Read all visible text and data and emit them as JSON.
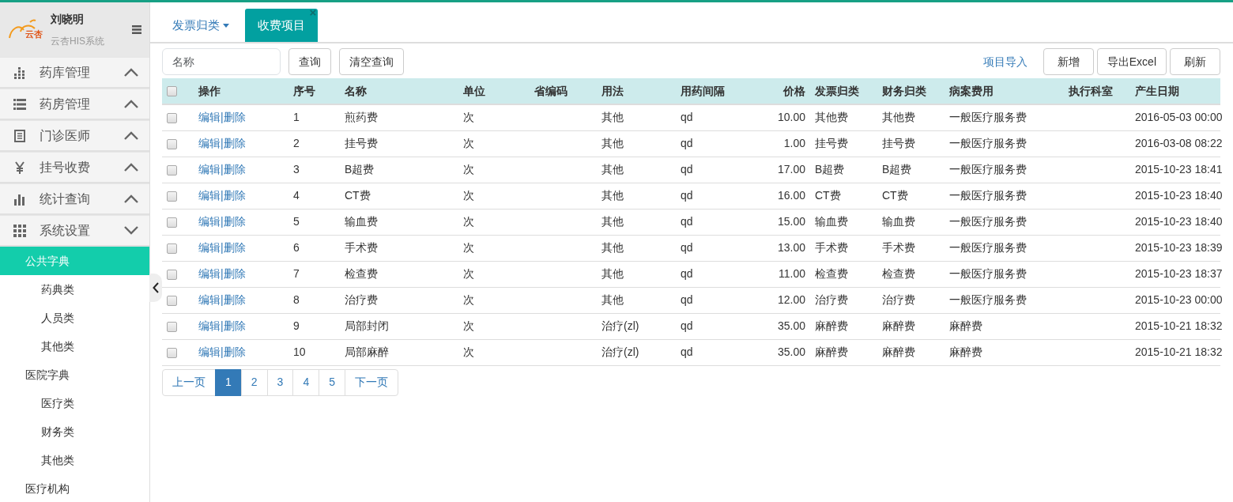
{
  "sidebar": {
    "logo_text": "云杏",
    "user_name": "刘晓明",
    "system_name": "云杏HIS系统",
    "menu": [
      {
        "label": "药库管理",
        "expanded": false
      },
      {
        "label": "药房管理",
        "expanded": false
      },
      {
        "label": "门诊医师",
        "expanded": false
      },
      {
        "label": "挂号收费",
        "expanded": false
      },
      {
        "label": "统计查询",
        "expanded": false
      },
      {
        "label": "系统设置",
        "expanded": true,
        "children": [
          {
            "label": "公共字典",
            "selected": true,
            "children": [
              {
                "label": "药典类",
                "selected": false
              },
              {
                "label": "人员类",
                "selected": false
              },
              {
                "label": "其他类",
                "selected": false
              }
            ]
          },
          {
            "label": "医院字典",
            "selected": false,
            "children": [
              {
                "label": "医疗类",
                "selected": false
              },
              {
                "label": "财务类",
                "selected": false
              },
              {
                "label": "其他类",
                "selected": false
              }
            ]
          },
          {
            "label": "医疗机构",
            "selected": false
          }
        ]
      }
    ]
  },
  "tabs": [
    {
      "label": "发票归类",
      "kind": "dropdown",
      "selected": false
    },
    {
      "label": "收费项目",
      "kind": "closable",
      "selected": true,
      "close": "×"
    }
  ],
  "toolbar": {
    "search": {
      "placeholder": "名称"
    },
    "left_buttons": [
      "查询",
      "清空查询"
    ],
    "import_link": "项目导入",
    "right_buttons": [
      "新增",
      "导出Excel",
      "刷新"
    ]
  },
  "table": {
    "select_all": false,
    "action_column": "操作",
    "columns": [
      "序号",
      "名称",
      "单位",
      "省编码",
      "用法",
      "用药间隔",
      "价格",
      "发票归类",
      "财务归类",
      "病案费用",
      "执行科室",
      "产生日期"
    ],
    "rows": [
      {
        "checked": false,
        "edit": "编辑",
        "sep": "|",
        "delete": "删除",
        "cells": [
          "1",
          "煎药费",
          "次",
          "",
          "其他",
          "qd",
          "10.00",
          "其他费",
          "其他费",
          "一般医疗服务费",
          "",
          "2016-05-03 00:00"
        ]
      },
      {
        "checked": false,
        "edit": "编辑",
        "sep": "|",
        "delete": "删除",
        "cells": [
          "2",
          "挂号费",
          "次",
          "",
          "其他",
          "qd",
          "1.00",
          "挂号费",
          "挂号费",
          "一般医疗服务费",
          "",
          "2016-03-08 08:22"
        ]
      },
      {
        "checked": false,
        "edit": "编辑",
        "sep": "|",
        "delete": "删除",
        "cells": [
          "3",
          "B超费",
          "次",
          "",
          "其他",
          "qd",
          "17.00",
          "B超费",
          "B超费",
          "一般医疗服务费",
          "",
          "2015-10-23 18:41"
        ]
      },
      {
        "checked": false,
        "edit": "编辑",
        "sep": "|",
        "delete": "删除",
        "cells": [
          "4",
          "CT费",
          "次",
          "",
          "其他",
          "qd",
          "16.00",
          "CT费",
          "CT费",
          "一般医疗服务费",
          "",
          "2015-10-23 18:40"
        ]
      },
      {
        "checked": false,
        "edit": "编辑",
        "sep": "|",
        "delete": "删除",
        "cells": [
          "5",
          "输血费",
          "次",
          "",
          "其他",
          "qd",
          "15.00",
          "输血费",
          "输血费",
          "一般医疗服务费",
          "",
          "2015-10-23 18:40"
        ]
      },
      {
        "checked": false,
        "edit": "编辑",
        "sep": "|",
        "delete": "删除",
        "cells": [
          "6",
          "手术费",
          "次",
          "",
          "其他",
          "qd",
          "13.00",
          "手术费",
          "手术费",
          "一般医疗服务费",
          "",
          "2015-10-23 18:39"
        ]
      },
      {
        "checked": false,
        "edit": "编辑",
        "sep": "|",
        "delete": "删除",
        "cells": [
          "7",
          "检查费",
          "次",
          "",
          "其他",
          "qd",
          "11.00",
          "检查费",
          "检查费",
          "一般医疗服务费",
          "",
          "2015-10-23 18:37"
        ]
      },
      {
        "checked": false,
        "edit": "编辑",
        "sep": "|",
        "delete": "删除",
        "cells": [
          "8",
          "治疗费",
          "次",
          "",
          "其他",
          "qd",
          "12.00",
          "治疗费",
          "治疗费",
          "一般医疗服务费",
          "",
          "2015-10-23 00:00"
        ]
      },
      {
        "checked": false,
        "edit": "编辑",
        "sep": "|",
        "delete": "删除",
        "cells": [
          "9",
          "局部封闭",
          "次",
          "",
          "治疗(zl)",
          "qd",
          "35.00",
          "麻醉费",
          "麻醉费",
          "麻醉费",
          "",
          "2015-10-21 18:32"
        ]
      },
      {
        "checked": false,
        "edit": "编辑",
        "sep": "|",
        "delete": "删除",
        "cells": [
          "10",
          "局部麻醉",
          "次",
          "",
          "治疗(zl)",
          "qd",
          "35.00",
          "麻醉费",
          "麻醉费",
          "麻醉费",
          "",
          "2015-10-21 18:32"
        ]
      }
    ]
  },
  "pagination": [
    {
      "label": "上一页",
      "selected": false
    },
    {
      "label": "1",
      "selected": true
    },
    {
      "label": "2",
      "selected": false
    },
    {
      "label": "3",
      "selected": false
    },
    {
      "label": "4",
      "selected": false
    },
    {
      "label": "5",
      "selected": false
    },
    {
      "label": "下一页",
      "selected": false
    }
  ]
}
